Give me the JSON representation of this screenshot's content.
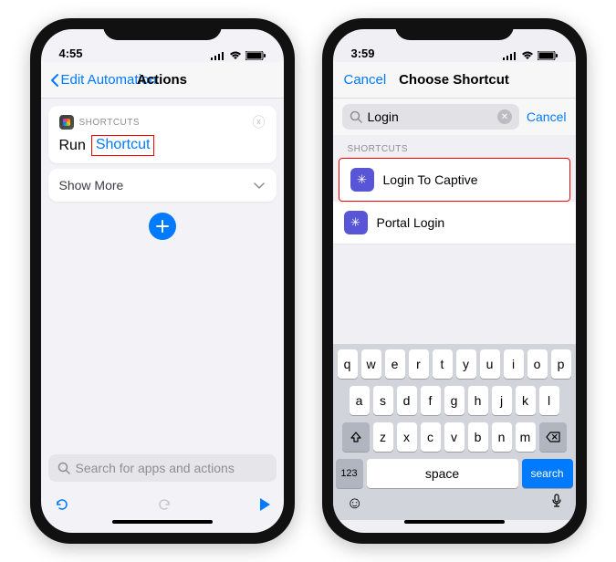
{
  "left": {
    "time": "4:55",
    "back_label": "Edit Automation",
    "title": "Actions",
    "card_label": "SHORTCUTS",
    "run_text": "Run",
    "shortcut_token": "Shortcut",
    "show_more": "Show More",
    "search_placeholder": "Search for apps and actions"
  },
  "right": {
    "time": "3:59",
    "cancel": "Cancel",
    "title": "Choose Shortcut",
    "search_value": "Login",
    "search_cancel": "Cancel",
    "section": "SHORTCUTS",
    "items": [
      {
        "label": "Login To Captive"
      },
      {
        "label": "Portal Login"
      }
    ],
    "keyboard": {
      "row1": [
        "q",
        "w",
        "e",
        "r",
        "t",
        "y",
        "u",
        "i",
        "o",
        "p"
      ],
      "row2": [
        "a",
        "s",
        "d",
        "f",
        "g",
        "h",
        "j",
        "k",
        "l"
      ],
      "row3": [
        "z",
        "x",
        "c",
        "v",
        "b",
        "n",
        "m"
      ],
      "num_key": "123",
      "space": "space",
      "search": "search"
    }
  }
}
